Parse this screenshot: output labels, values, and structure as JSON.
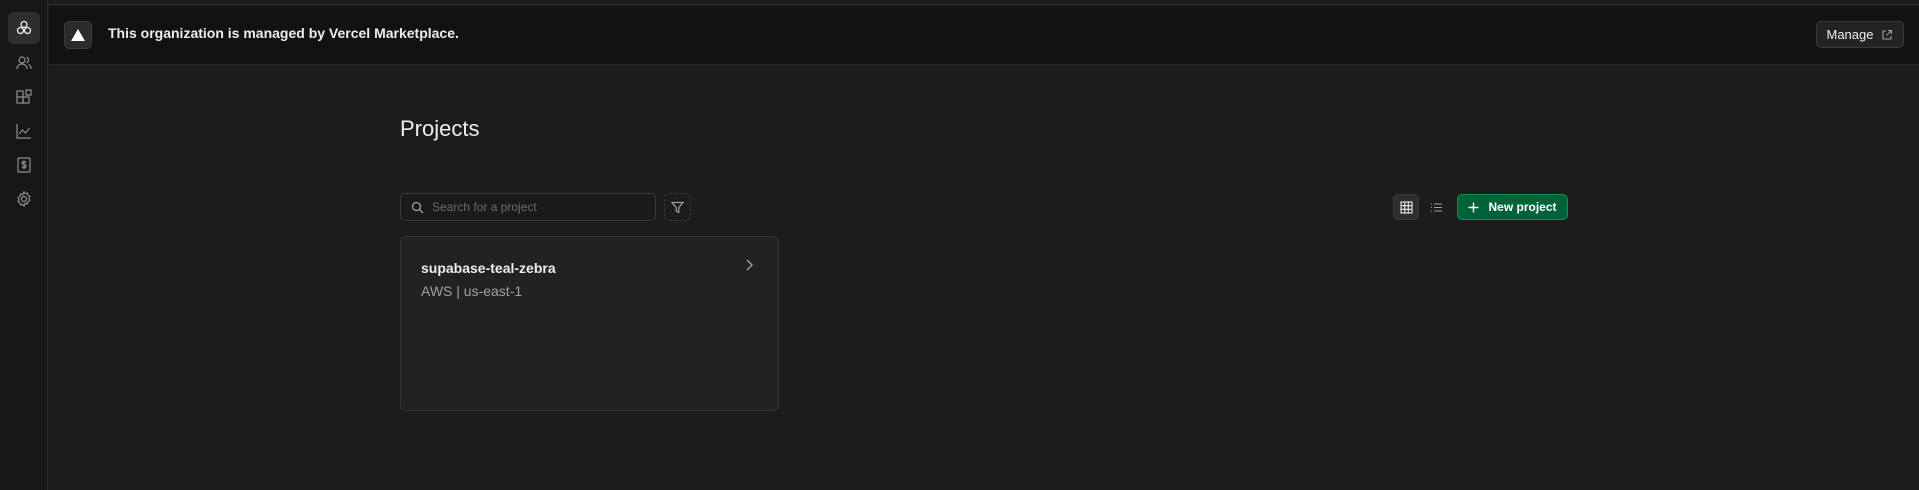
{
  "sidebar": {
    "items": [
      {
        "name": "projects",
        "icon": "projects-icon",
        "active": true
      },
      {
        "name": "team",
        "icon": "team-icon",
        "active": false
      },
      {
        "name": "integrations",
        "icon": "integrations-icon",
        "active": false
      },
      {
        "name": "usage",
        "icon": "usage-chart-icon",
        "active": false
      },
      {
        "name": "billing",
        "icon": "billing-icon",
        "active": false
      },
      {
        "name": "settings",
        "icon": "gear-icon",
        "active": false
      }
    ]
  },
  "banner": {
    "text": "This organization is managed by Vercel Marketplace.",
    "manage_label": "Manage",
    "logo_icon": "vercel-triangle-icon"
  },
  "main": {
    "title": "Projects",
    "search": {
      "placeholder": "Search for a project",
      "value": ""
    },
    "filter_icon": "filter-icon",
    "view_modes": [
      "grid",
      "list"
    ],
    "active_view": "grid",
    "new_project_label": "New project",
    "projects": [
      {
        "name": "supabase-teal-zebra",
        "region": "AWS | us-east-1"
      }
    ]
  },
  "colors": {
    "background": "#1c1c1c",
    "sidebar": "#171717",
    "banner": "#121212",
    "accent_green": "#006239",
    "card": "#222222"
  }
}
